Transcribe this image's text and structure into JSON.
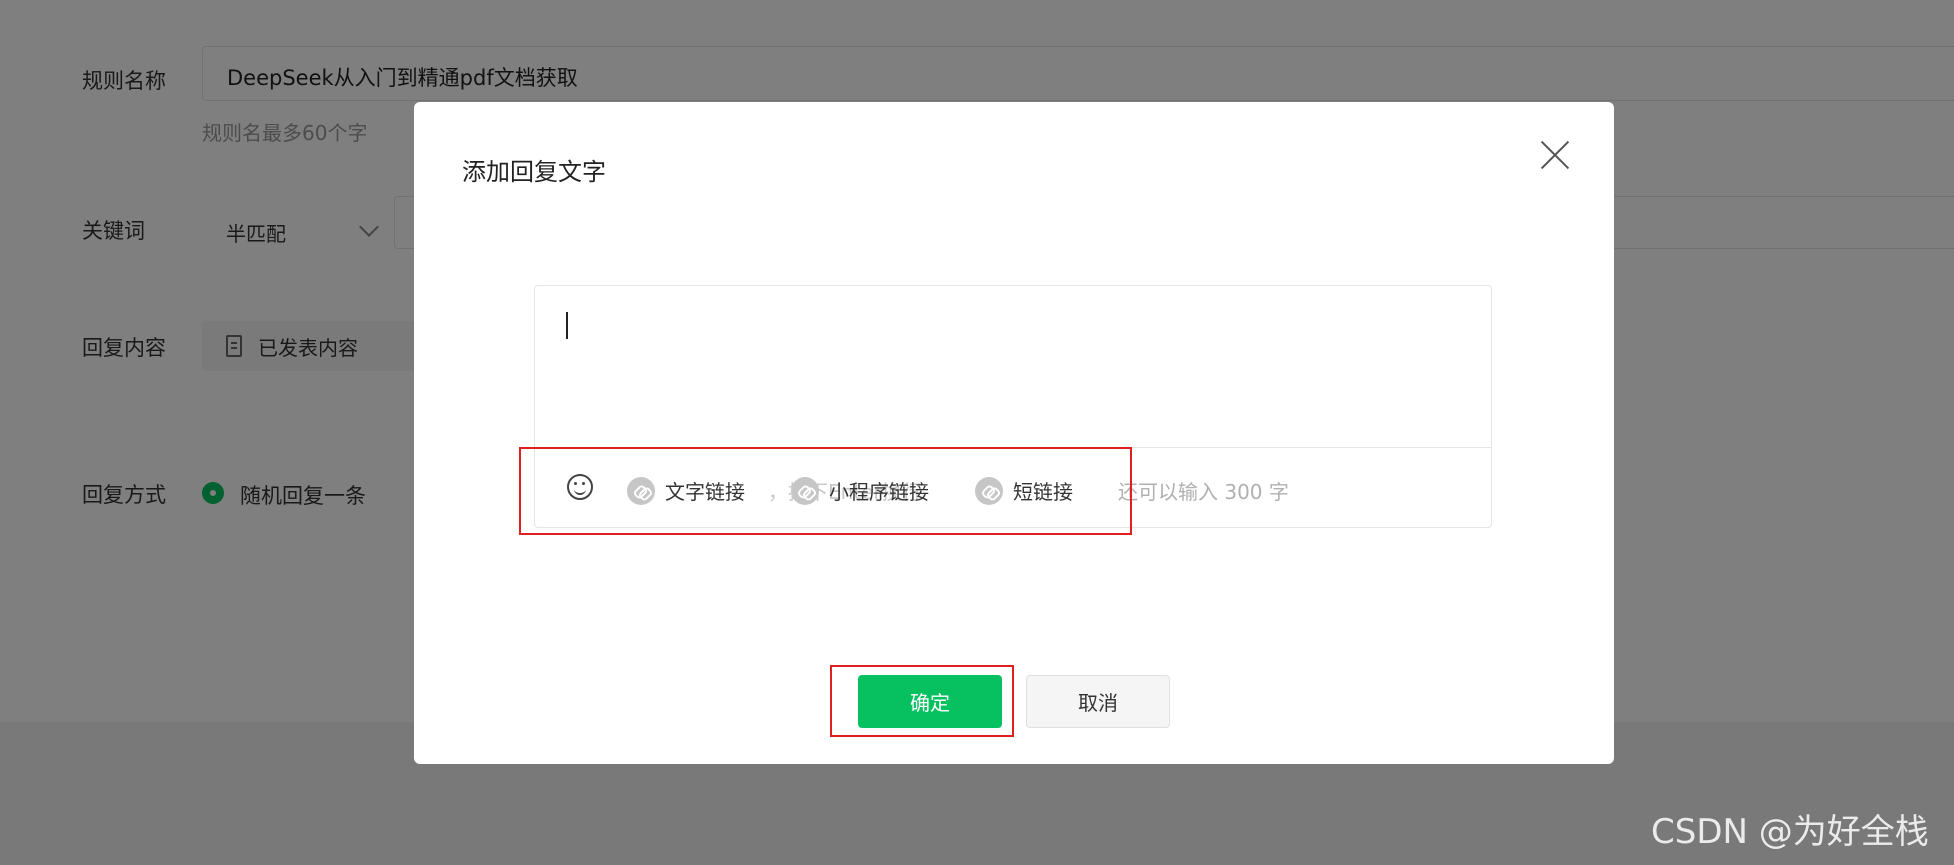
{
  "form": {
    "rule_name_label": "规则名称",
    "rule_name_value": "DeepSeek从入门到精通pdf文档获取",
    "rule_name_hint": "规则名最多60个字",
    "keyword_label": "关键词",
    "keyword_match": "半匹配",
    "reply_content_label": "回复内容",
    "reply_content_item": "已发表内容",
    "reply_mode_label": "回复方式",
    "reply_mode_option": "随机回复一条"
  },
  "dialog": {
    "title": "添加回复文字",
    "editor_value": "",
    "toolbar": {
      "emoji_icon": "smile-icon",
      "text_link": "文字链接",
      "ghost_text": "，按下Enter换行",
      "miniprogram_link": "小程序链接",
      "short_link": "短链接",
      "counter": "还可以输入 300 字"
    },
    "confirm_label": "确定",
    "cancel_label": "取消"
  },
  "watermark": "CSDN @为好全栈",
  "colors": {
    "primary": "#07c160",
    "highlight": "#e02020",
    "overlay": "rgba(0,0,0,0.5)"
  }
}
